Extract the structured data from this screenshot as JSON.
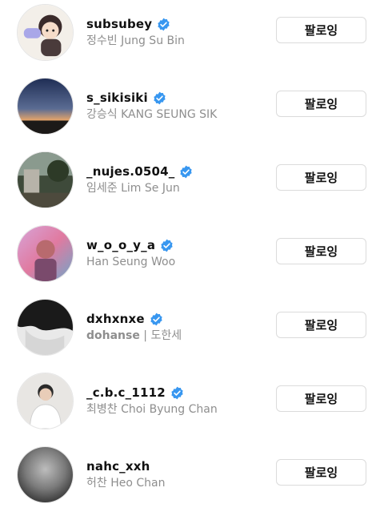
{
  "accent_verified": "#3897f0",
  "button_label": "팔로잉",
  "rows": [
    {
      "username": "subsubey",
      "name": "정수빈 Jung Su Bin",
      "avatar": "cartoon-character-avatar"
    },
    {
      "username": "s_sikisiki",
      "name": "강승식 KANG SEUNG SIK",
      "avatar": "sunset-landscape-avatar"
    },
    {
      "username": "_nujes.0504_",
      "name": "임세준 Lim Se Jun",
      "avatar": "garden-photo-avatar"
    },
    {
      "username": "w_o_o_y_a",
      "name": "Han Seung Woo",
      "avatar": "colorful-portrait-avatar"
    },
    {
      "username": "dxhxnxe",
      "name_bold": "dohanse",
      "name_rest": " | 도한세",
      "avatar": "black-white-hair-avatar"
    },
    {
      "username": "_c.b.c_1112",
      "name": "최병찬 Choi Byung Chan",
      "avatar": "man-white-shirt-avatar"
    },
    {
      "username": "nahc_xxh",
      "name": "허찬 Heo Chan",
      "avatar": "grey-sphere-avatar"
    }
  ]
}
